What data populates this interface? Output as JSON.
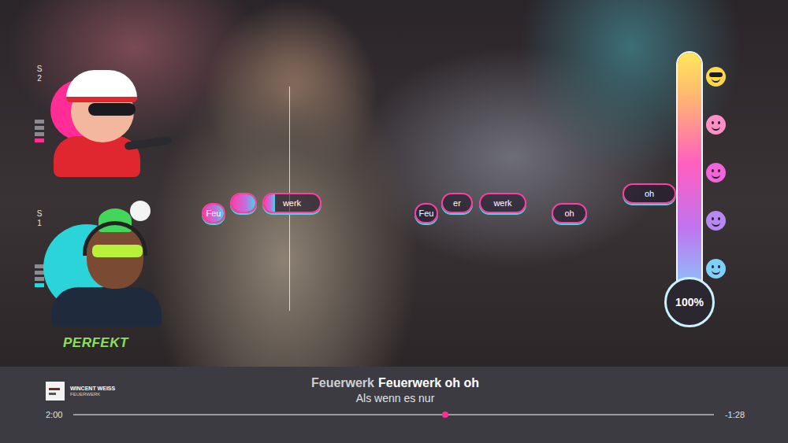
{
  "players": [
    {
      "label": "S 2",
      "level": 0.25,
      "color": "#ff2d95"
    },
    {
      "label": "S 1",
      "level": 0.25,
      "color": "#2ad4d8"
    }
  ],
  "feedback": "PERFEKT",
  "notes": [
    {
      "text": "Feu",
      "level": 1
    },
    {
      "level": 1
    },
    {
      "text": "werk",
      "level": 0.2
    },
    {
      "text": "Feu",
      "level": 0
    },
    {
      "text": "er",
      "level": 0
    },
    {
      "text": "werk",
      "level": 0
    },
    {
      "text": "oh",
      "level": 0
    },
    {
      "text": "oh",
      "level": 0
    }
  ],
  "meter": {
    "level": 1,
    "reading": "100%"
  },
  "song": {
    "artist": "WINCENT WEISS",
    "title": "FEUERWERK"
  },
  "lyrics": {
    "current": [
      {
        "text": "Feuerwerk",
        "sung": true
      },
      {
        "text": "Feuerwerk oh oh",
        "sung": false
      }
    ],
    "next": "Als wenn es nur"
  },
  "progress": {
    "elapsed": "2:00",
    "remaining": "-1:28",
    "level": 0.58
  }
}
